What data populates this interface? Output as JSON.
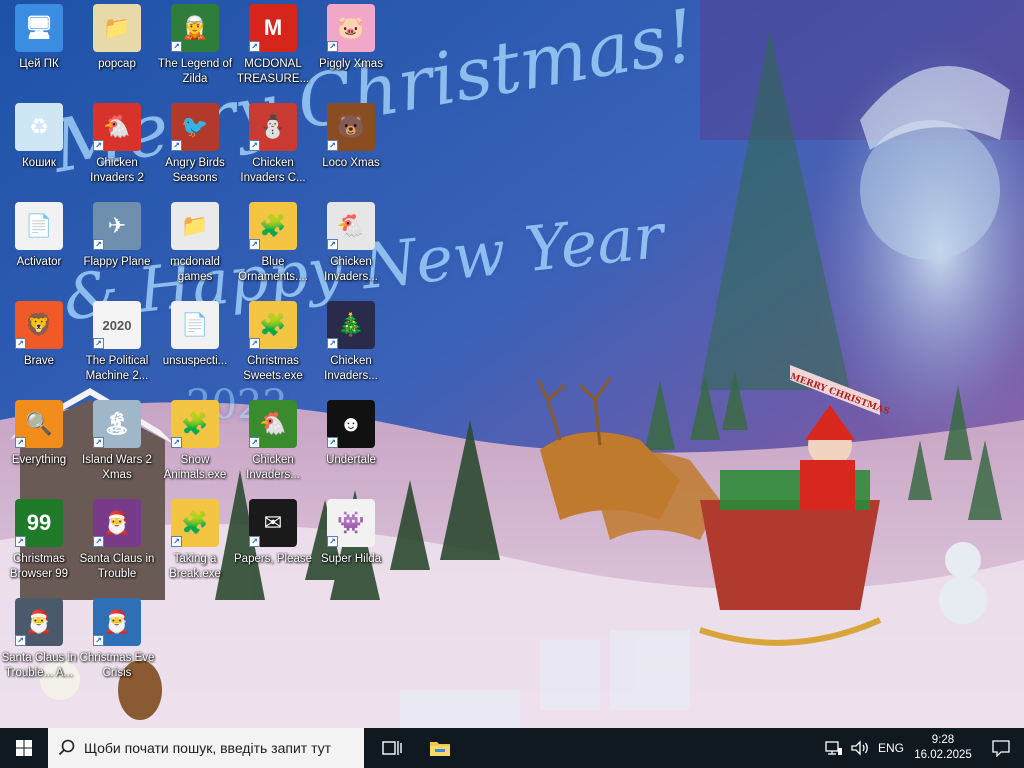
{
  "wallpaper": {
    "greeting_line1": "Merry Christmas!",
    "greeting_line2": "& Happy New Year",
    "year": "2022",
    "banner": "MERRY CHRISTMAS"
  },
  "desktop_icons": [
    {
      "id": "this-pc",
      "label": "Цей ПК",
      "glyph": "🖥",
      "bg": "#3a8de0",
      "shortcut": false
    },
    {
      "id": "popcap",
      "label": "popcap",
      "glyph": "📁",
      "bg": "#e8d9a8",
      "shortcut": false
    },
    {
      "id": "legend-of-zilda",
      "label": "The Legend of Zilda",
      "glyph": "🧝",
      "bg": "#2e7d3a",
      "shortcut": true
    },
    {
      "id": "mcdonald-treasure",
      "label": "MCDONAL TREASURE...",
      "glyph": "M",
      "bg": "#d6261c",
      "shortcut": true
    },
    {
      "id": "piggly-xmas",
      "label": "Piggly Xmas",
      "glyph": "🐷",
      "bg": "#f1a8c8",
      "shortcut": true
    },
    {
      "id": "recycle-bin",
      "label": "Кошик",
      "glyph": "♻",
      "bg": "#cfe7f5",
      "shortcut": false
    },
    {
      "id": "chicken-invaders-2",
      "label": "Chicken Invaders 2",
      "glyph": "🐔",
      "bg": "#d7332b",
      "shortcut": true
    },
    {
      "id": "angry-birds-seasons",
      "label": "Angry Birds Seasons",
      "glyph": "🐦",
      "bg": "#b33a2a",
      "shortcut": true
    },
    {
      "id": "chicken-invaders-c",
      "label": "Chicken Invaders C...",
      "glyph": "⛄",
      "bg": "#c83a32",
      "shortcut": true
    },
    {
      "id": "loco-xmas",
      "label": "Loco Xmas",
      "glyph": "🐻",
      "bg": "#8a4d22",
      "shortcut": true
    },
    {
      "id": "activator",
      "label": "Activator",
      "glyph": "📄",
      "bg": "#f2f2f2",
      "shortcut": false
    },
    {
      "id": "flappy-plane",
      "label": "Flappy Plane",
      "glyph": "✈",
      "bg": "#6e8fae",
      "shortcut": true
    },
    {
      "id": "mcdonald-games",
      "label": "mcdonald games",
      "glyph": "📁",
      "bg": "#eaeaea",
      "shortcut": false
    },
    {
      "id": "blue-ornaments",
      "label": "Blue Ornaments....",
      "glyph": "🧩",
      "bg": "#f4c542",
      "shortcut": true
    },
    {
      "id": "chicken-invaders-a",
      "label": "Chicken Invaders...",
      "glyph": "🐔",
      "bg": "#e6e6e6",
      "shortcut": true
    },
    {
      "id": "brave",
      "label": "Brave",
      "glyph": "🦁",
      "bg": "#f05a28",
      "shortcut": true
    },
    {
      "id": "political-machine",
      "label": "The Political Machine 2...",
      "glyph": "2020",
      "bg": "#f4f4f4",
      "shortcut": true
    },
    {
      "id": "unsuspecting",
      "label": "unsuspecti...",
      "glyph": "📄",
      "bg": "#f2f2f2",
      "shortcut": false
    },
    {
      "id": "christmas-sweets",
      "label": "Christmas Sweets.exe",
      "glyph": "🧩",
      "bg": "#f4c542",
      "shortcut": true
    },
    {
      "id": "chicken-invaders-b",
      "label": "Chicken Invaders...",
      "glyph": "🎄",
      "bg": "#2a2a4a",
      "shortcut": true
    },
    {
      "id": "everything",
      "label": "Everything",
      "glyph": "🔍",
      "bg": "#f28c1a",
      "shortcut": true
    },
    {
      "id": "island-wars-2",
      "label": "Island Wars 2 Xmas",
      "glyph": "🏝",
      "bg": "#9fb7c8",
      "shortcut": true
    },
    {
      "id": "snow-animals",
      "label": "Snow Animals.exe",
      "glyph": "🧩",
      "bg": "#f4c542",
      "shortcut": true
    },
    {
      "id": "chicken-invaders-d",
      "label": "Chicken Invaders...",
      "glyph": "🐔",
      "bg": "#3a8a2e",
      "shortcut": true
    },
    {
      "id": "undertale",
      "label": "Undertale",
      "glyph": "☻",
      "bg": "#111111",
      "shortcut": true
    },
    {
      "id": "christmas-browser-99",
      "label": "Christmas Browser 99",
      "glyph": "99",
      "bg": "#1f7a2a",
      "shortcut": true
    },
    {
      "id": "santa-claus-in-trouble",
      "label": "Santa Claus in Trouble",
      "glyph": "🎅",
      "bg": "#7a3a8a",
      "shortcut": true
    },
    {
      "id": "taking-a-break",
      "label": "Taking a Break.exe",
      "glyph": "🧩",
      "bg": "#f4c542",
      "shortcut": true
    },
    {
      "id": "papers-please",
      "label": "Papers, Please",
      "glyph": "✉",
      "bg": "#1a1a1a",
      "shortcut": true
    },
    {
      "id": "super-hilda",
      "label": "Super Hilda",
      "glyph": "👾",
      "bg": "#f2f2f2",
      "shortcut": true
    },
    {
      "id": "santa-claus-in-trouble-a",
      "label": "Santa Claus in Trouble... A...",
      "glyph": "🎅",
      "bg": "#4a5a6a",
      "shortcut": true
    },
    {
      "id": "christmas-eve-crisis",
      "label": "Christmas Eve Crisis",
      "glyph": "🎅",
      "bg": "#2f6fb5",
      "shortcut": true
    }
  ],
  "taskbar": {
    "search_placeholder": "Щоби почати пошук, введіть запит тут",
    "language": "ENG",
    "time": "9:28",
    "date": "16.02.2025"
  }
}
